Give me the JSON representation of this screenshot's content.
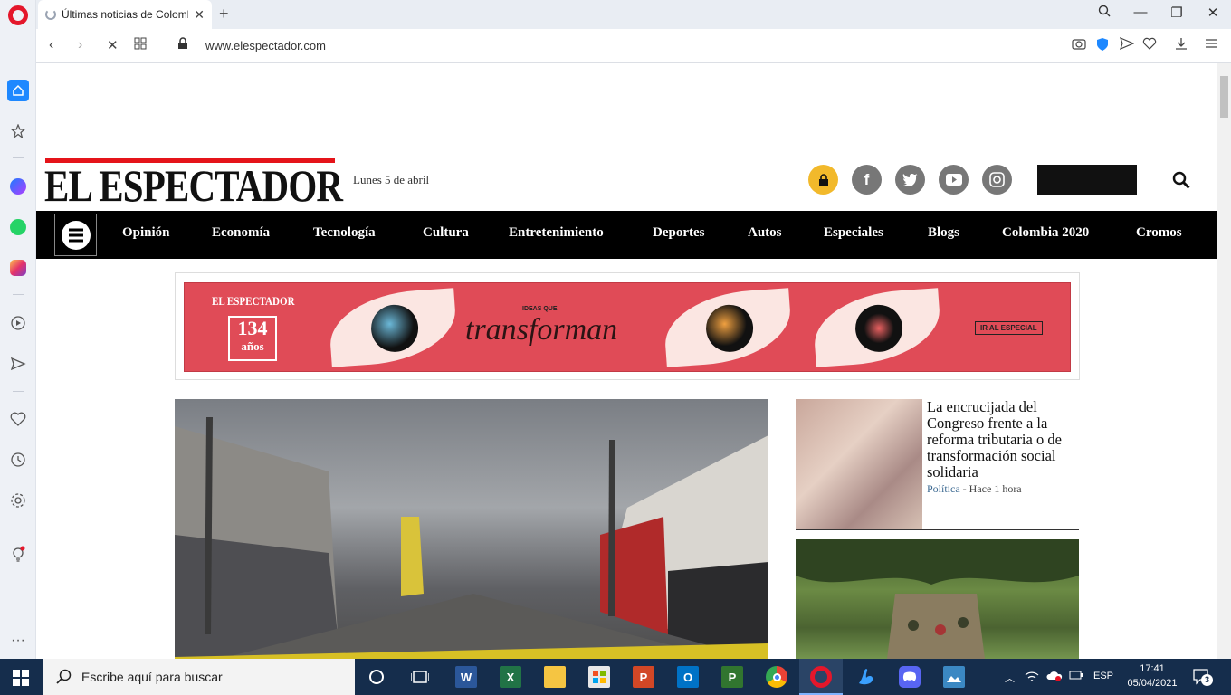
{
  "browser": {
    "tab_title": "Últimas noticias de Colombia",
    "url": "www.elespectador.com",
    "new_tab_symbol": "+",
    "close_tab_symbol": "✕"
  },
  "site": {
    "logo": "EL ESPECTADOR",
    "date": "Lunes 5 de abril",
    "menu": [
      "Opinión",
      "Economía",
      "Tecnología",
      "Cultura",
      "Entretenimiento",
      "Deportes",
      "Autos",
      "Especiales",
      "Blogs",
      "Colombia 2020",
      "Cromos"
    ],
    "social_icons": [
      "lock-icon",
      "facebook-icon",
      "twitter-icon",
      "youtube-icon",
      "instagram-icon"
    ]
  },
  "banner": {
    "brand": "EL ESPECTADOR",
    "years_number": "134",
    "years_word": "años",
    "small_text": "IDEAS QUE",
    "big_text": "transforman",
    "cta": "IR AL ESPECIAL",
    "bg_color": "#e04b57"
  },
  "articles": {
    "side1": {
      "title": "La encrucijada del Congreso frente a la reforma tributaria o de transformación social solidaria",
      "section": "Política",
      "time": "- Hace 1 hora"
    }
  },
  "taskbar": {
    "search_placeholder": "Escribe aquí para buscar",
    "lang": "ESP",
    "time": "17:41",
    "date": "05/04/2021",
    "notifications": "3"
  }
}
